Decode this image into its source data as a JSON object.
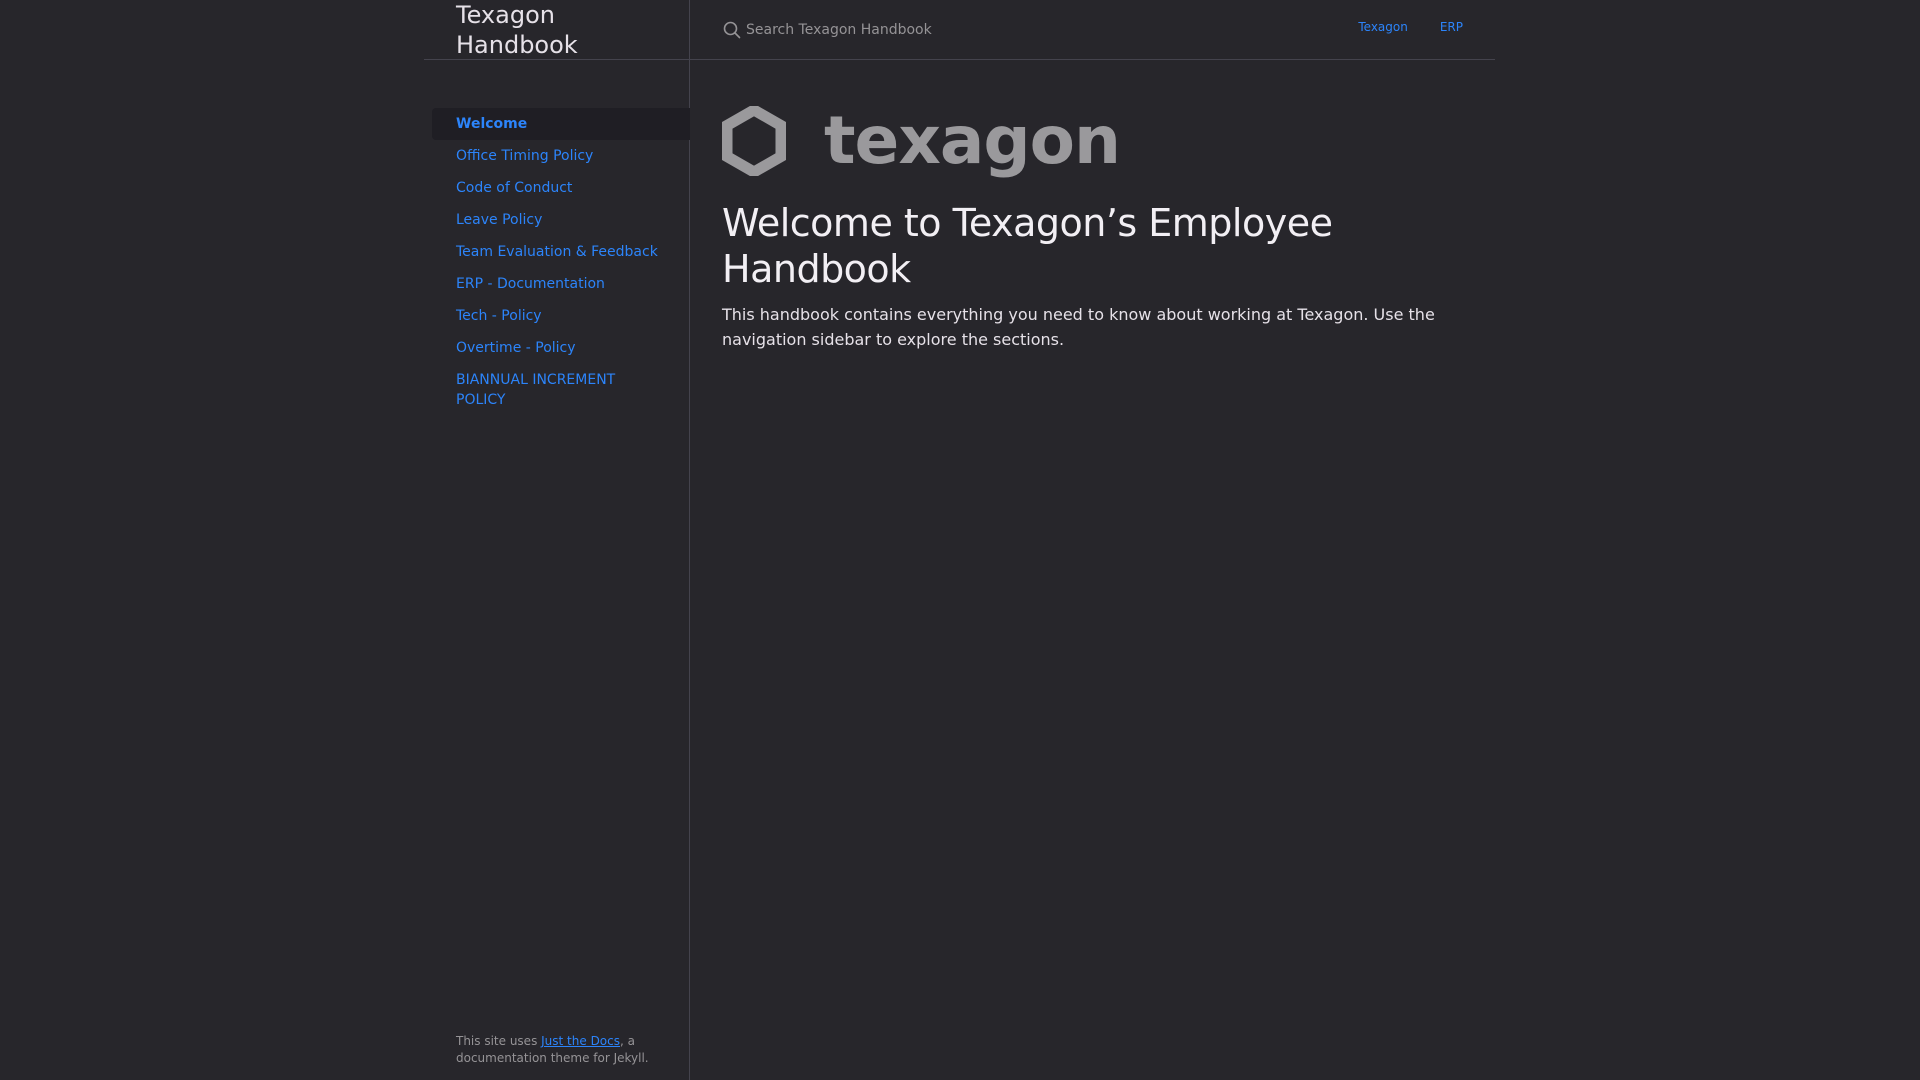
{
  "site": {
    "title": "Texagon Handbook"
  },
  "search": {
    "placeholder": "Search Texagon Handbook"
  },
  "aux_nav": [
    {
      "label": "Texagon"
    },
    {
      "label": "ERP"
    }
  ],
  "sidebar": {
    "items": [
      {
        "label": "Welcome",
        "active": true
      },
      {
        "label": "Office Timing Policy"
      },
      {
        "label": "Code of Conduct"
      },
      {
        "label": "Leave Policy"
      },
      {
        "label": "Team Evaluation & Feedback"
      },
      {
        "label": "ERP - Documentation"
      },
      {
        "label": "Tech - Policy"
      },
      {
        "label": "Overtime - Policy"
      },
      {
        "label": "BIANNUAL INCREMENT POLICY"
      }
    ],
    "footer": {
      "prefix": "This site uses ",
      "link": "Just the Docs",
      "suffix": ", a documentation theme for Jekyll."
    }
  },
  "main": {
    "logo_text": "texagon",
    "heading": "Welcome to Texagon’s Employee Handbook",
    "intro": "This handbook contains everything you need to know about working at Texagon. Use the navigation sidebar to explore the sections."
  },
  "colors": {
    "background": "#27262b",
    "link": "#2c84fa",
    "active_bg": "#1f1e24",
    "border": "#44434d",
    "logo": "#9a999c"
  },
  "icons": {
    "search": "search-icon",
    "logo": "hexagon-logo-icon"
  }
}
